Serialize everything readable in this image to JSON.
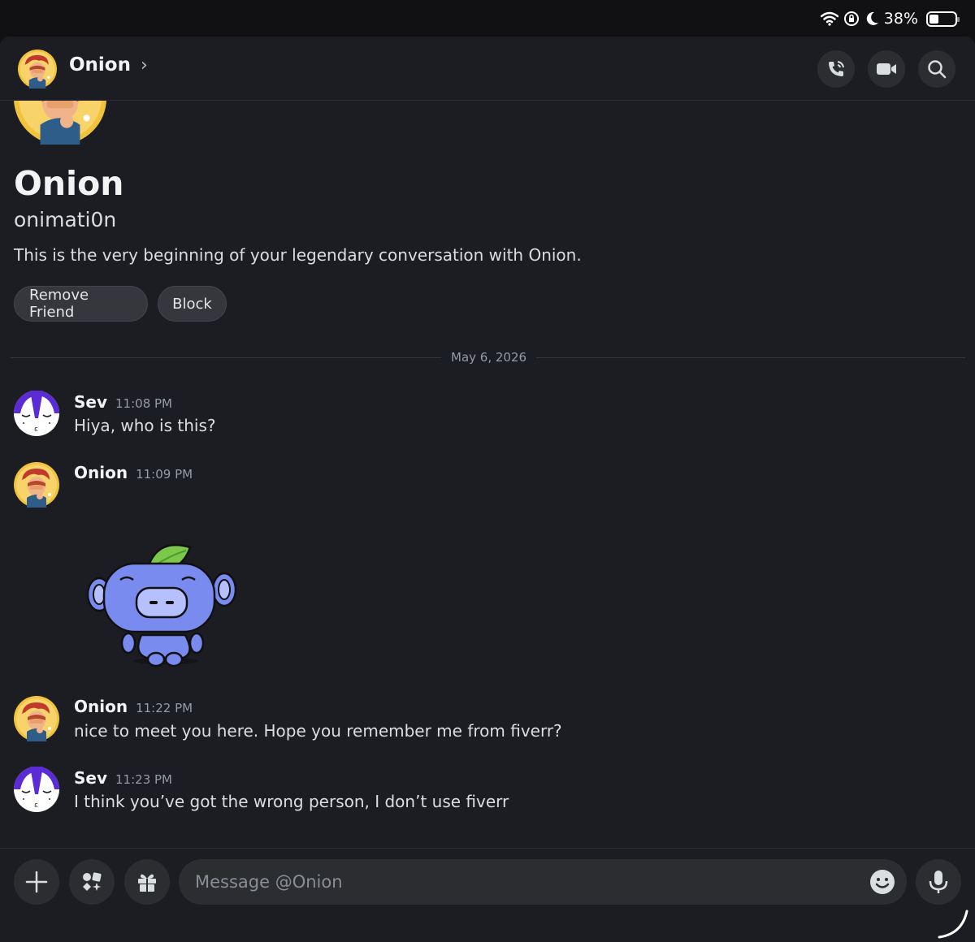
{
  "status_bar": {
    "battery": "38%"
  },
  "header": {
    "title": "Onion",
    "chevron": "›"
  },
  "profile": {
    "name": "Onion",
    "username": "onimati0n",
    "description": "This is the very beginning of your legendary conversation with Onion.",
    "actions": [
      "Remove Friend",
      "Block"
    ]
  },
  "date_divider": "May 6, 2026",
  "messages": [
    {
      "author": "Sev",
      "time": "11:08 PM",
      "text": "Hiya, who is this?",
      "avatar": "sev-avatar"
    },
    {
      "author": "Onion",
      "time": "11:09 PM",
      "text": "",
      "avatar": "onion-avatar",
      "sticker": "wumpus-sticker"
    },
    {
      "author": "Onion",
      "time": "11:22 PM",
      "text": "nice to meet you here. Hope you remember me from fiverr?",
      "avatar": "onion-avatar"
    },
    {
      "author": "Sev",
      "time": "11:23 PM",
      "text": "I think you’ve got the wrong person, I don’t use fiverr",
      "avatar": "sev-avatar"
    }
  ],
  "composer": {
    "placeholder": "Message @Onion"
  },
  "icons": [
    "wifi-icon",
    "lock-rotation-icon",
    "moon-icon",
    "battery-icon",
    "phone-icon",
    "video-icon",
    "search-icon",
    "plus-icon",
    "apps-icon",
    "gift-icon",
    "emoji-icon",
    "mic-icon"
  ],
  "colors": {
    "background": "#1c1d22",
    "surface": "#2b2d31",
    "text": "#dbdee1",
    "muted": "#949ba4",
    "sev_purple": "#5b2bd6",
    "onion_gold": "#f2c23a"
  }
}
